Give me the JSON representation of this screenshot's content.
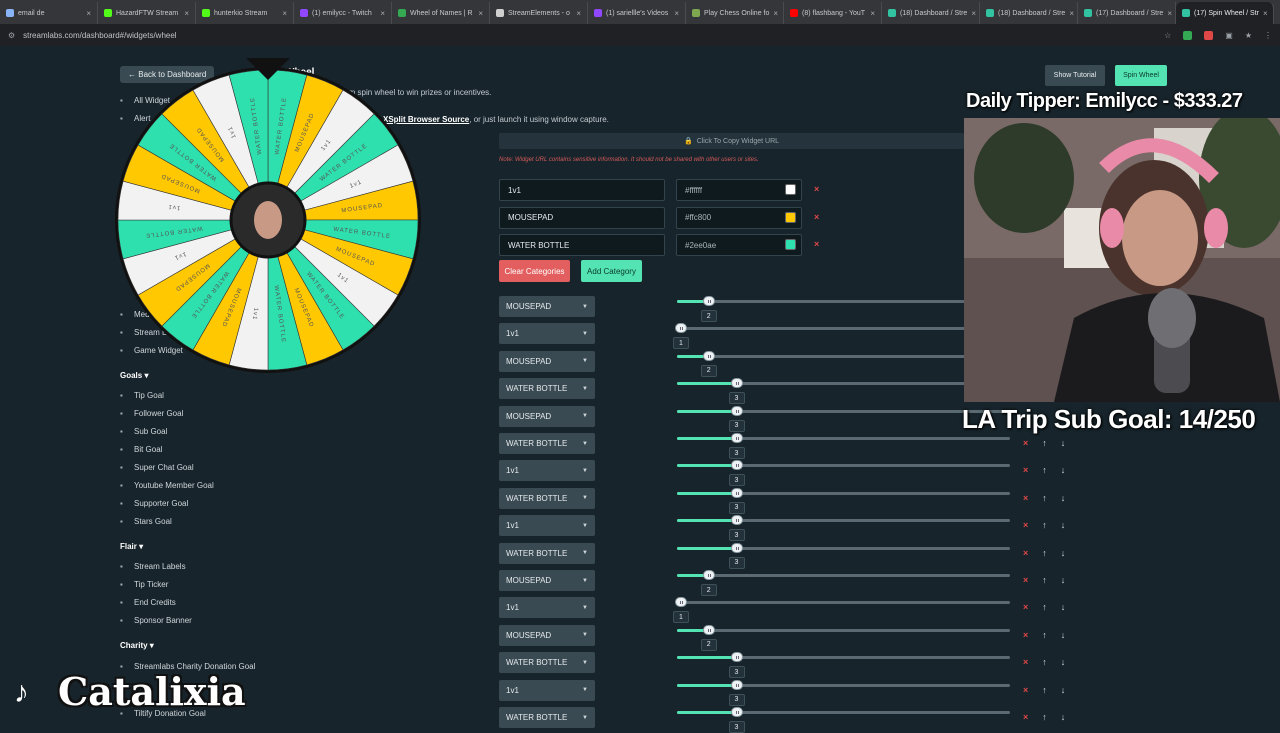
{
  "browser": {
    "tabs": [
      {
        "label": "email de",
        "color": "#8ab4f8"
      },
      {
        "label": "HazardFTW Stream",
        "color": "#53fc18"
      },
      {
        "label": "hunterkio Stream",
        "color": "#53fc18"
      },
      {
        "label": "(1) emilycc - Twitch",
        "color": "#9147ff"
      },
      {
        "label": "Wheel of Names | R",
        "color": "#34a853"
      },
      {
        "label": "StreamElements - o",
        "color": "#cfcfcf"
      },
      {
        "label": "(1) sariellle's Videos",
        "color": "#9147ff"
      },
      {
        "label": "Play Chess Online fo",
        "color": "#7fa650"
      },
      {
        "label": "(8) flashbang - YouT",
        "color": "#ff0000"
      },
      {
        "label": "(18) Dashboard / Stre",
        "color": "#31c3a2"
      },
      {
        "label": "(18) Dashboard / Stre",
        "color": "#31c3a2"
      },
      {
        "label": "(17) Dashboard / Stre",
        "color": "#31c3a2"
      },
      {
        "label": "(17) Spin Wheel / Str",
        "color": "#31c3a2"
      }
    ],
    "active_tab": 12,
    "new_tab": "+",
    "close": "×",
    "url": "streamlabs.com/dashboard#/widgets/wheel"
  },
  "page": {
    "back_button": "Back to Dashboard",
    "title": "Wheel",
    "subtitle": "stom spin wheel to win prizes or incentives.",
    "source_hint_link": "XSplit Browser Source",
    "source_hint_rest": ", or just launch it using window capture.",
    "copy_url": "Click To Copy Widget URL",
    "url_warning": "Note: Widget URL contains sensitive information. It should not be shared with other users or sites.",
    "show_tutorial": "Show Tutorial",
    "spin_wheel": "Spin Wheel",
    "clear_categories": "Clear Categories",
    "add_category": "Add Category"
  },
  "sidebar": {
    "top": [
      {
        "label": "All Widget",
        "icon": "grid-icon"
      },
      {
        "label": "Alert",
        "icon": "bell-icon"
      }
    ],
    "mid": [
      {
        "label": "Med",
        "icon": "media-icon"
      },
      {
        "label": "Stream L",
        "icon": "wrench-icon"
      },
      {
        "label": "Game Widget",
        "icon": "gamepad-icon"
      }
    ],
    "goals_heading": "Goals",
    "goals": [
      "Tip Goal",
      "Follower Goal",
      "Sub Goal",
      "Bit Goal",
      "Super Chat Goal",
      "Youtube Member Goal",
      "Supporter Goal",
      "Stars Goal"
    ],
    "flair_heading": "Flair",
    "flair": [
      "Stream Labels",
      "Tip Ticker",
      "End Credits",
      "Sponsor Banner"
    ],
    "charity_heading": "Charity",
    "charity": [
      "Streamlabs Charity Donation Goal",
      "Tiltify Donation Goal"
    ]
  },
  "categories": [
    {
      "name": "1v1",
      "color": "#ffffff"
    },
    {
      "name": "MOUSEPAD",
      "color": "#ffc800"
    },
    {
      "name": "WATER BOTTLE",
      "color": "#2ee0ae"
    }
  ],
  "slices": [
    {
      "name": "MOUSEPAD",
      "weight": 2,
      "controls": false
    },
    {
      "name": "1v1",
      "weight": 1,
      "controls": false
    },
    {
      "name": "MOUSEPAD",
      "weight": 2,
      "controls": false
    },
    {
      "name": "WATER BOTTLE",
      "weight": 3,
      "controls": false
    },
    {
      "name": "MOUSEPAD",
      "weight": 3,
      "controls": false
    },
    {
      "name": "WATER BOTTLE",
      "weight": 3,
      "controls": true
    },
    {
      "name": "1v1",
      "weight": 3,
      "controls": true
    },
    {
      "name": "WATER BOTTLE",
      "weight": 3,
      "controls": true
    },
    {
      "name": "1v1",
      "weight": 3,
      "controls": true
    },
    {
      "name": "WATER BOTTLE",
      "weight": 3,
      "controls": true
    },
    {
      "name": "MOUSEPAD",
      "weight": 2,
      "controls": true
    },
    {
      "name": "1v1",
      "weight": 1,
      "controls": true
    },
    {
      "name": "MOUSEPAD",
      "weight": 2,
      "controls": true
    },
    {
      "name": "WATER BOTTLE",
      "weight": 3,
      "controls": true
    },
    {
      "name": "1v1",
      "weight": 3,
      "controls": true
    },
    {
      "name": "WATER BOTTLE",
      "weight": 3,
      "controls": true
    }
  ],
  "controls": {
    "remove": "×",
    "up": "↑",
    "down": "↓",
    "caret": "▼"
  },
  "overlay": {
    "daily_tipper": "Daily Tipper: Emilycc - $333.27",
    "sub_goal": "LA Trip Sub Goal: 14/250",
    "channel": "Catalixia",
    "tiktok_glyph": "♪"
  },
  "wheel": {
    "segment_colors": [
      "#2ee0ae",
      "#ffc800",
      "#f2f2f2",
      "#2ee0ae",
      "#f2f2f2",
      "#ffc800",
      "#2ee0ae",
      "#ffc800",
      "#f2f2f2",
      "#2ee0ae",
      "#ffc800",
      "#2ee0ae",
      "#f2f2f2",
      "#ffc800",
      "#2ee0ae",
      "#ffc800",
      "#f2f2f2",
      "#2ee0ae",
      "#f2f2f2",
      "#ffc800",
      "#2ee0ae",
      "#ffc800",
      "#f2f2f2",
      "#2ee0ae"
    ],
    "segment_labels": [
      "WATER BOTTLE",
      "MOUSEPAD",
      "1v1",
      "WATER BOTTLE",
      "1v1",
      "MOUSEPAD",
      "WATER BOTTLE",
      "MOUSEPAD",
      "1v1",
      "WATER BOTTLE",
      "MOUSEPAD",
      "WATER BOTTLE",
      "1v1",
      "MOUSEPAD",
      "WATER BOTTLE",
      "MOUSEPAD",
      "1v1",
      "WATER BOTTLE",
      "1v1",
      "MOUSEPAD",
      "WATER BOTTLE",
      "MOUSEPAD",
      "1v1",
      "WATER BOTTLE"
    ]
  }
}
